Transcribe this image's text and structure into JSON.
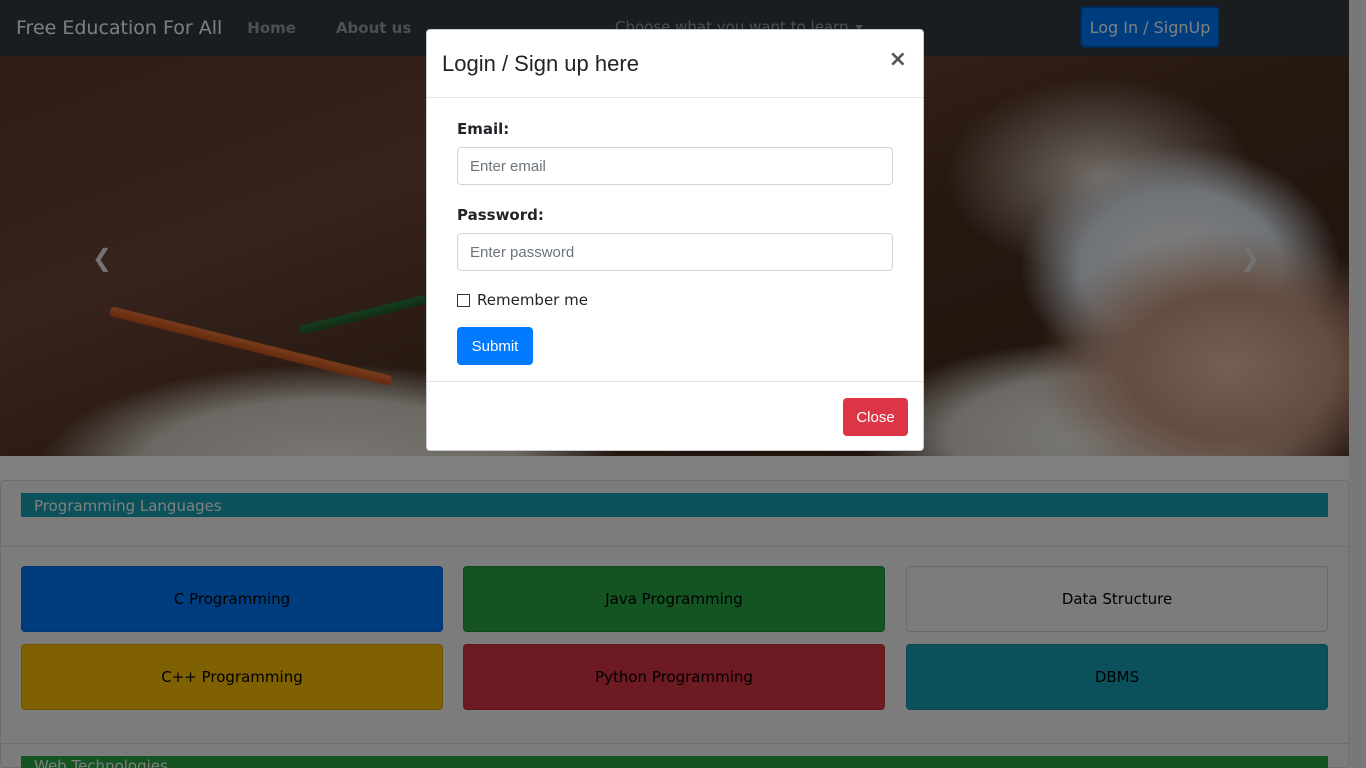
{
  "navbar": {
    "brand": "Free Education For All",
    "links": [
      "Home",
      "About us"
    ],
    "dropdown_label": "Choose what you want to learn",
    "login_button": "Log In / SignUp"
  },
  "carousel": {
    "prev_icon": "chevron-left-icon",
    "next_icon": "chevron-right-icon"
  },
  "sections": [
    {
      "title": "Programming Languages",
      "color": "#17a2b8",
      "courses": [
        {
          "label": "C Programming",
          "color": "#007bff"
        },
        {
          "label": "Java Programming",
          "color": "#28a745"
        },
        {
          "label": "Data Structure",
          "color": "#f8f9fa"
        },
        {
          "label": "C++ Programming",
          "color": "#ffc107"
        },
        {
          "label": "Python Programming",
          "color": "#dc3545"
        },
        {
          "label": "DBMS",
          "color": "#17a2b8"
        }
      ]
    },
    {
      "title": "Web Technologies",
      "color": "#28a745"
    }
  ],
  "modal": {
    "title": "Login / Sign up here",
    "close_x": "×",
    "email_label": "Email:",
    "email_placeholder": "Enter email",
    "password_label": "Password:",
    "password_placeholder": "Enter password",
    "remember_label": "Remember me",
    "submit_label": "Submit",
    "close_label": "Close"
  },
  "colors": {
    "navbar": "#343a40",
    "primary": "#007bff",
    "danger": "#dc3545"
  }
}
